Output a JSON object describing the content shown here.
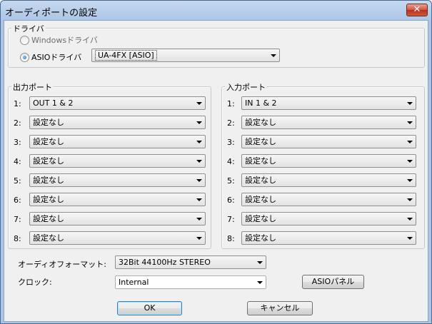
{
  "window": {
    "title": "オーディポートの設定",
    "close_label": "✕"
  },
  "driver_group": {
    "label": "ドライバ",
    "windows_label": "Windowsドライバ",
    "asio_label": "ASIOドライバ",
    "asio_value": "UA-4FX [ASIO]"
  },
  "output_group": {
    "label": "出力ポート",
    "ports": [
      {
        "num": "1:",
        "value": "OUT 1 & 2"
      },
      {
        "num": "2:",
        "value": "設定なし"
      },
      {
        "num": "3:",
        "value": "設定なし"
      },
      {
        "num": "4:",
        "value": "設定なし"
      },
      {
        "num": "5:",
        "value": "設定なし"
      },
      {
        "num": "6:",
        "value": "設定なし"
      },
      {
        "num": "7:",
        "value": "設定なし"
      },
      {
        "num": "8:",
        "value": "設定なし"
      }
    ]
  },
  "input_group": {
    "label": "入力ポート",
    "ports": [
      {
        "num": "1:",
        "value": "IN 1 & 2"
      },
      {
        "num": "2:",
        "value": "設定なし"
      },
      {
        "num": "3:",
        "value": "設定なし"
      },
      {
        "num": "4:",
        "value": "設定なし"
      },
      {
        "num": "5:",
        "value": "設定なし"
      },
      {
        "num": "6:",
        "value": "設定なし"
      },
      {
        "num": "7:",
        "value": "設定なし"
      },
      {
        "num": "8:",
        "value": "設定なし"
      }
    ]
  },
  "format": {
    "label": "オーディオフォーマット:",
    "value": "32Bit  44100Hz STEREO"
  },
  "clock": {
    "label": "クロック:",
    "value": "Internal"
  },
  "buttons": {
    "asio_panel": "ASIOパネル",
    "ok": "OK",
    "cancel": "キャンセル"
  }
}
